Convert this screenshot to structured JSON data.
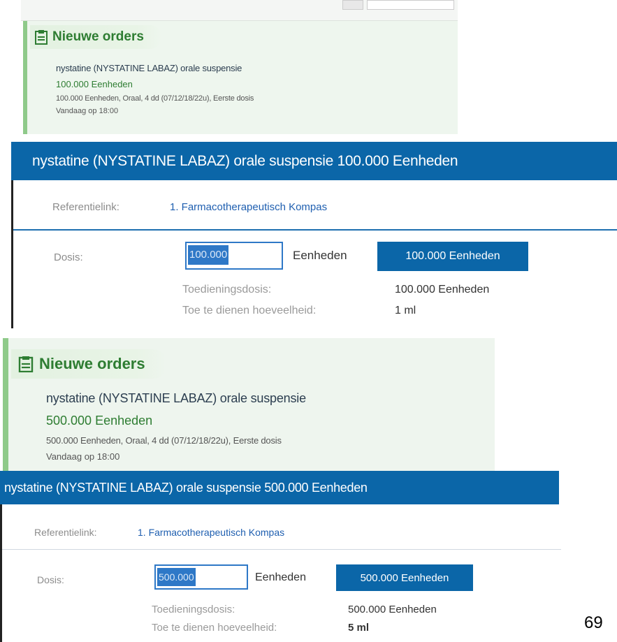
{
  "top_section": {
    "orders_title": "Nieuwe orders",
    "order_name": "nystatine (NYSTATINE LABAZ) orale suspensie",
    "order_dose": "100.000 Eenheden",
    "order_detail": "100.000 Eenheden, Oraal, 4 dd (07/12/18/22u), Eerste dosis",
    "order_time": "Vandaag op 18:00",
    "window_title": "nystatine (NYSTATINE LABAZ) orale suspensie 100.000 Eenheden",
    "ref_label": "Referentielink:",
    "ref_link": "1. Farmacotherapeutisch Kompas",
    "dose_label": "Dosis:",
    "dose_input_value": "100.000",
    "dose_unit": "Eenheden",
    "dose_chip": "100.000 Eenheden",
    "admin_dose_label": "Toedieningsdosis:",
    "admin_dose_value": "100.000 Eenheden",
    "amount_label": "Toe te dienen hoeveelheid:",
    "amount_value": "1 ml"
  },
  "bottom_section": {
    "orders_title": "Nieuwe orders",
    "order_name": "nystatine (NYSTATINE LABAZ) orale suspensie",
    "order_dose": "500.000 Eenheden",
    "order_detail": "500.000 Eenheden, Oraal, 4 dd (07/12/18/22u), Eerste dosis",
    "order_time": "Vandaag op 18:00",
    "window_title": "nystatine (NYSTATINE LABAZ) orale suspensie 500.000 Eenheden",
    "ref_label": "Referentielink:",
    "ref_link": "1. Farmacotherapeutisch Kompas",
    "dose_label": "Dosis:",
    "dose_input_value": "500.000",
    "dose_unit": "Eenheden",
    "dose_chip": "500.000 Eenheden",
    "admin_dose_label": "Toedieningsdosis:",
    "admin_dose_value": "500.000 Eenheden",
    "amount_label": "Toe te dienen hoeveelheid:",
    "amount_value": "5 ml"
  },
  "page_number": "69",
  "colors": {
    "accent_blue": "#0b66a8",
    "order_green": "#2e7d32",
    "panel_green_bg": "#eef6ee",
    "link_blue": "#1f5fb0"
  },
  "icons": {
    "orders_icon": "clipboard-icon"
  }
}
